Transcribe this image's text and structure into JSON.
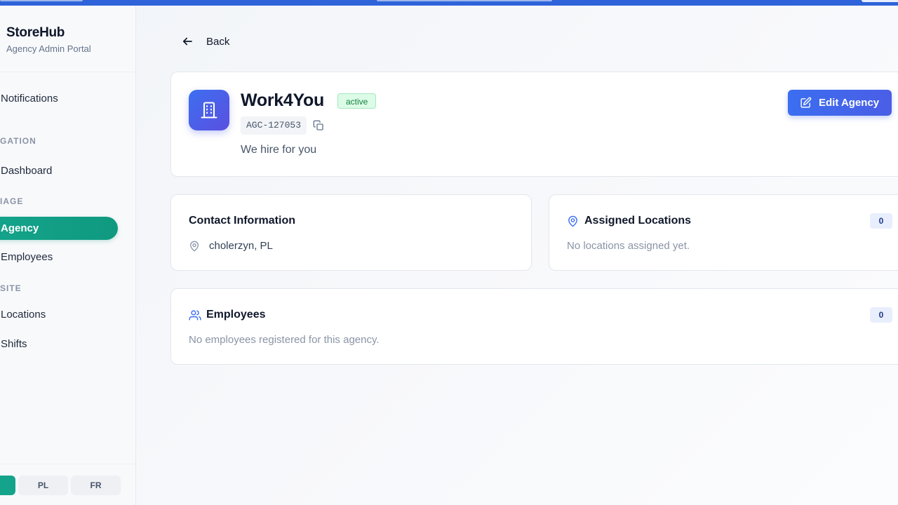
{
  "sidebar": {
    "brand": {
      "title": "StoreHub",
      "subtitle": "Agency Admin Portal"
    },
    "notifications_label": "Notifications",
    "sections": {
      "navigation": "GATION",
      "manage": "IAGE",
      "site": "SITE"
    },
    "items": {
      "dashboard": "Dashboard",
      "agency": "Agency",
      "employees": "Employees",
      "locations": "Locations",
      "shifts": "Shifts"
    },
    "languages": {
      "pl": "PL",
      "fr": "FR"
    }
  },
  "header": {
    "back_label": "Back",
    "agency_name": "Work4You",
    "status": "active",
    "agency_code": "AGC-127053",
    "description": "We hire for you",
    "edit_label": "Edit Agency"
  },
  "contact": {
    "title": "Contact Information",
    "location": "cholerzyn, PL"
  },
  "assigned_locations": {
    "title": "Assigned Locations",
    "count": "0",
    "empty_text": "No locations assigned yet."
  },
  "employees": {
    "title": "Employees",
    "count": "0",
    "empty_text": "No employees registered for this agency."
  },
  "colors": {
    "accent_blue": "#3b6ef0",
    "accent_green": "#14a38b",
    "status_green_bg": "#dcfce7",
    "status_green_text": "#15803d"
  },
  "icons": {
    "back": "arrow-left-icon",
    "agency": "building-icon",
    "copy": "copy-icon",
    "edit": "edit-icon",
    "map_pin": "map-pin-icon",
    "users": "users-icon"
  }
}
